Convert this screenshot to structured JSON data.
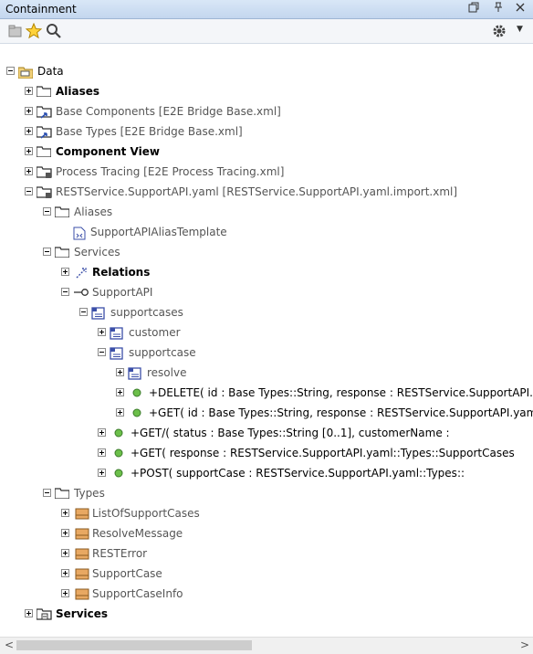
{
  "panel": {
    "title": "Containment",
    "restore_icon": "restore-window-icon",
    "pin_icon": "pin-icon",
    "close_icon": "close-icon"
  },
  "toolbar": {
    "new_icon": "new-element-icon",
    "favorite_icon": "star-icon",
    "search_icon": "search-icon",
    "settings_icon": "gear-icon"
  },
  "tree": {
    "root": "Data",
    "n_aliases": "Aliases",
    "n_base_components": "Base Components [E2E Bridge Base.xml]",
    "n_base_types": "Base Types [E2E Bridge Base.xml]",
    "n_component_view": "Component View",
    "n_process_tracing": "Process Tracing [E2E Process Tracing.xml]",
    "n_rest_service": "RESTService.SupportAPI.yaml [RESTService.SupportAPI.yaml.import.xml]",
    "n_aliases2": "Aliases",
    "n_alias_template": "SupportAPIAliasTemplate",
    "n_services": "Services",
    "n_relations": "Relations",
    "n_supportapi": "SupportAPI",
    "n_supportcases": "supportcases",
    "n_customer": "customer",
    "n_supportcase": "supportcase",
    "n_resolve": "resolve",
    "n_delete": "+DELETE( id : Base Types::String, response : RESTService.SupportAPI.yaml::Types::",
    "n_get_id": "+GET( id : Base Types::String, response : RESTService.SupportAPI.yaml::Types::",
    "n_get_status": "+GET/( status : Base Types::String [0..1], customerName : ",
    "n_get_response": "+GET( response : RESTService.SupportAPI.yaml::Types::SupportCases",
    "n_post": "+POST( supportCase : RESTService.SupportAPI.yaml::Types::",
    "n_types": "Types",
    "n_list_support_cases": "ListOfSupportCases",
    "n_resolve_message": "ResolveMessage",
    "n_rest_error": "RESTError",
    "n_support_case": "SupportCase",
    "n_support_case_info": "SupportCaseInfo",
    "n_services_root": "Services"
  },
  "scrollbar": {
    "left_arrow": "<",
    "right_arrow": ">"
  },
  "colors": {
    "folder": "#3a3a3a",
    "class_box": "#d68b4a",
    "operation": "#4a9a3a",
    "package_blue": "#3b4fa8"
  }
}
